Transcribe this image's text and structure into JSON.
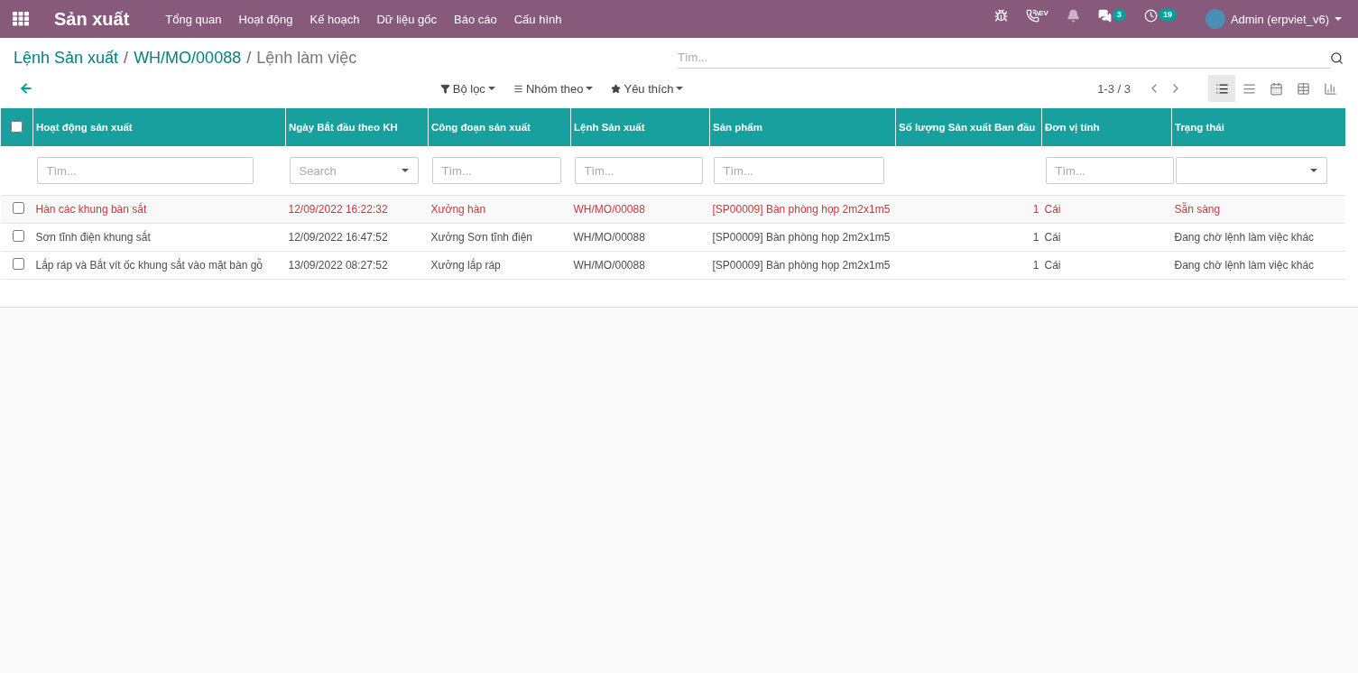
{
  "navbar": {
    "app_title": "Sản xuất",
    "menu": [
      "Tổng quan",
      "Hoạt động",
      "Kế hoạch",
      "Dữ liệu gốc",
      "Báo cáo",
      "Cấu hình"
    ],
    "systray": [
      {
        "kind": "debug"
      },
      {
        "kind": "phone",
        "label": "EV"
      },
      {
        "kind": "bell"
      },
      {
        "kind": "chat",
        "badge": "3"
      },
      {
        "kind": "activity",
        "badge": "19"
      }
    ],
    "user": "Admin (erpviet_v6)"
  },
  "breadcrumb": [
    {
      "label": "Lệnh Sản xuất",
      "link": true
    },
    {
      "separator_before": "/",
      "label": "WH/MO/00088",
      "link": true
    },
    {
      "separator_before": "/",
      "label": "Lệnh làm việc",
      "link": false
    }
  ],
  "search": {
    "placeholder": "Tìm..."
  },
  "filters": [
    {
      "kind": "filter",
      "label": "Bộ lọc"
    },
    {
      "kind": "group",
      "label": "Nhóm theo"
    },
    {
      "kind": "favorite",
      "label": "Yêu thích"
    }
  ],
  "pager": "1-3 / 3",
  "views": [
    {
      "kind": "list",
      "selected": true
    },
    {
      "kind": "gantt",
      "selected": false
    },
    {
      "kind": "calendar",
      "selected": false
    },
    {
      "kind": "pivot",
      "selected": false
    },
    {
      "kind": "graph",
      "selected": false
    }
  ],
  "table": {
    "select_all": {
      "checked": false
    },
    "columns": [
      {
        "label": "Hoạt động sản xuất",
        "filter": {
          "kind": "text",
          "placeholder": "Tìm..."
        }
      },
      {
        "label": "Ngày Bắt đầu theo KH",
        "filter": {
          "kind": "select",
          "placeholder": "Search"
        }
      },
      {
        "label": "Công đoạn sản xuất",
        "filter": {
          "kind": "text",
          "placeholder": "Tìm..."
        }
      },
      {
        "label": "Lệnh Sản xuất",
        "filter": {
          "kind": "text",
          "placeholder": "Tìm..."
        }
      },
      {
        "label": "Sản phẩm",
        "filter": {
          "kind": "text",
          "placeholder": "Tìm..."
        }
      },
      {
        "label": "Số lượng Sản xuất Ban đầu",
        "filter": {
          "kind": "none"
        }
      },
      {
        "label": "Đơn vị tính",
        "filter": {
          "kind": "text",
          "placeholder": "Tìm..."
        }
      },
      {
        "label": "Trạng thái",
        "filter": {
          "kind": "select"
        }
      }
    ],
    "rows": [
      {
        "selected": false,
        "highlighted": true,
        "cells": [
          "Hàn các khung bàn sắt",
          "12/09/2022 16:22:32",
          "Xưởng hàn",
          "WH/MO/00088",
          "[SP00009] Bàn phòng họp 2m2x1m5",
          "1",
          "Cái",
          "Sẵn sàng"
        ]
      },
      {
        "selected": false,
        "highlighted": false,
        "cells": [
          "Sơn tĩnh điện khung sắt",
          "12/09/2022 16:47:52",
          "Xưởng Sơn tĩnh điện",
          "WH/MO/00088",
          "[SP00009] Bàn phòng họp 2m2x1m5",
          "1",
          "Cái",
          "Đang chờ lệnh làm việc khác"
        ]
      },
      {
        "selected": false,
        "highlighted": false,
        "cells": [
          "Lắp ráp và Bắt vít ốc khung sắt vào mặt bàn gỗ",
          "13/09/2022 08:27:52",
          "Xưởng lắp ráp",
          "WH/MO/00088",
          "[SP00009] Bàn phòng họp 2m2x1m5",
          "1",
          "Cái",
          "Đang chờ lệnh làm việc khác"
        ]
      }
    ]
  }
}
